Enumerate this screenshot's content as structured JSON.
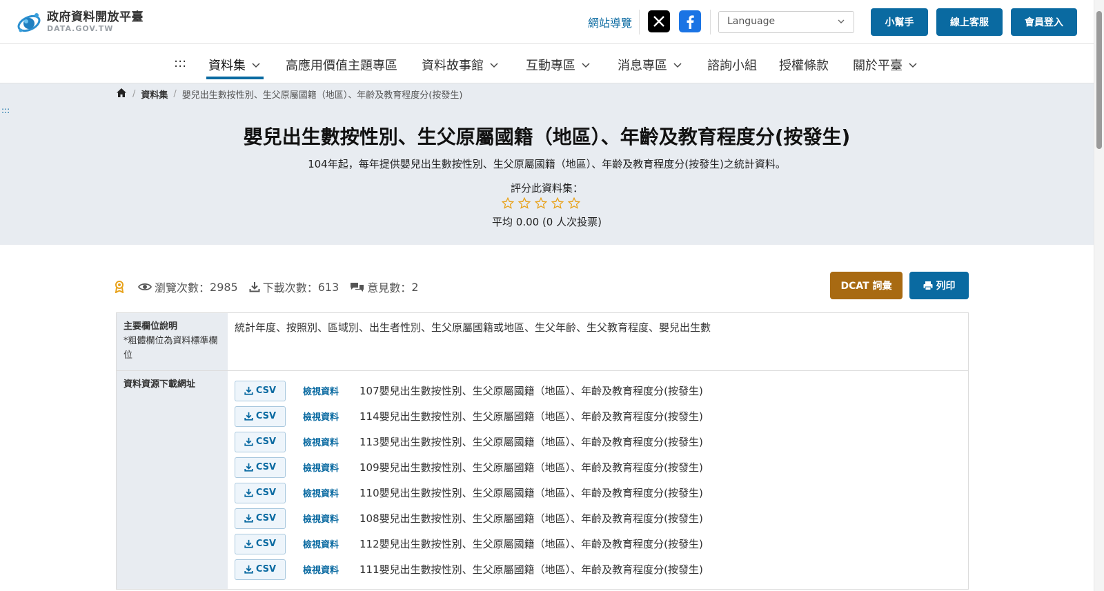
{
  "header": {
    "logo_title": "政府資料開放平臺",
    "logo_sub": "DATA.GOV.TW",
    "sitemap": "網站導覽",
    "language_placeholder": "Language",
    "btn_helper": "小幫手",
    "btn_service": "線上客服",
    "btn_login": "會員登入",
    "brand_color": "#0a6aa1"
  },
  "nav": {
    "dots": ":::",
    "items": [
      "資料集",
      "高應用價值主題專區",
      "資料故事館",
      "互動專區",
      "消息專區",
      "諮詢小組",
      "授權條款",
      "關於平臺"
    ]
  },
  "hero": {
    "breadcrumb": [
      "資料集",
      "嬰兒出生數按性別、生父原屬國籍（地區）、年齡及教育程度分(按發生)"
    ],
    "side_dots": ":::",
    "title": "嬰兒出生數按性別、生父原屬國籍（地區）、年齡及教育程度分(按發生)",
    "description": "104年起，每年提供嬰兒出生數按性別、生父原屬國籍（地區）、年齡及教育程度分(按發生)之統計資料。",
    "rate_label": "評分此資料集：",
    "rating": 0,
    "rating_max": 5,
    "rate_avg": "平均 0.00 (0 人次投票)"
  },
  "stats": {
    "views_label": "瀏覽次數：",
    "views": "2985",
    "downloads_label": "下載次數：",
    "downloads": "613",
    "comments_label": "意見數：",
    "comments": "2",
    "dcat": "DCAT 詞彙",
    "print": "列印"
  },
  "info": {
    "fields_head": "主要欄位說明",
    "fields_note": "*粗體欄位為資料標準欄位",
    "fields_value": "統計年度、按照別、區域別、出生者性別、生父原屬國籍或地區、生父年齡、生父教育程度、嬰兒出生數",
    "resources_head": "資料資源下載網址",
    "csv_label": "CSV",
    "view_label": "檢視資料",
    "resources": [
      "107嬰兒出生數按性別、生父原屬國籍（地區）、年齡及教育程度分(按發生)",
      "114嬰兒出生數按性別、生父原屬國籍（地區）、年齡及教育程度分(按發生)",
      "113嬰兒出生數按性別、生父原屬國籍（地區）、年齡及教育程度分(按發生)",
      "109嬰兒出生數按性別、生父原屬國籍（地區）、年齡及教育程度分(按發生)",
      "110嬰兒出生數按性別、生父原屬國籍（地區）、年齡及教育程度分(按發生)",
      "108嬰兒出生數按性別、生父原屬國籍（地區）、年齡及教育程度分(按發生)",
      "112嬰兒出生數按性別、生父原屬國籍（地區）、年齡及教育程度分(按發生)",
      "111嬰兒出生數按性別、生父原屬國籍（地區）、年齡及教育程度分(按發生)"
    ]
  }
}
